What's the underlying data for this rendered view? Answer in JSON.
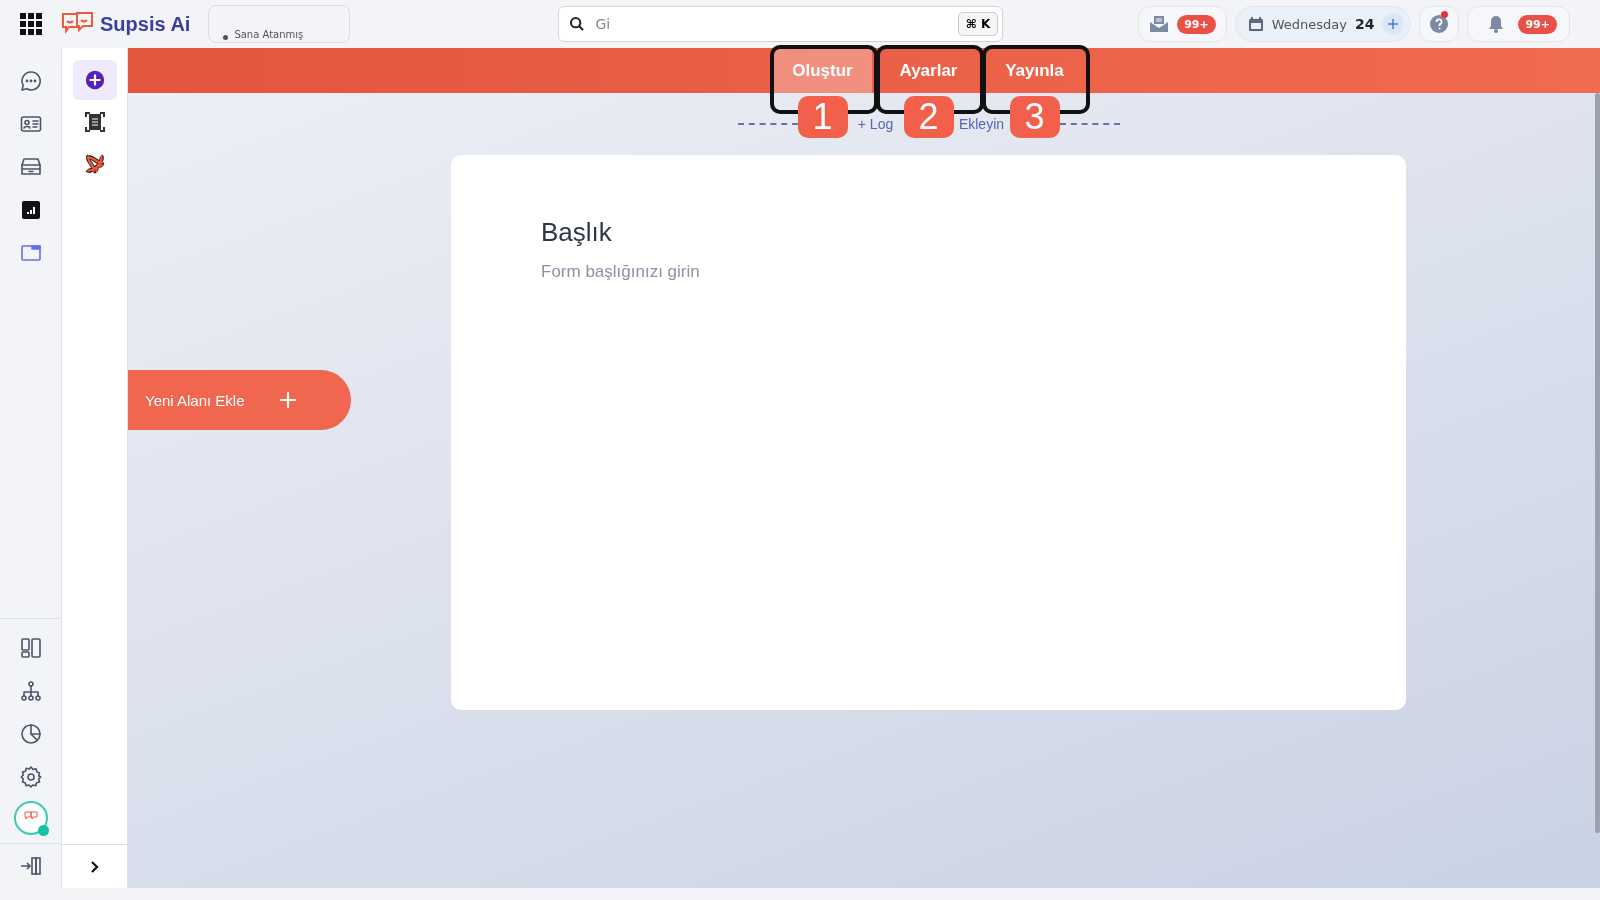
{
  "topbar": {
    "brand": "Supsis Ai",
    "assigned_filter": "Sana Atanmış",
    "search": {
      "placeholder": "Gi",
      "shortcut": "⌘ K"
    },
    "mail_badge": "99+",
    "date": {
      "day": "Wednesday",
      "date": "24"
    },
    "help_alert": true,
    "notifications_badge": "99+"
  },
  "rail": [
    {
      "kind": "chat",
      "selected": false
    },
    {
      "kind": "contact",
      "selected": false
    },
    {
      "kind": "inbox",
      "selected": false
    },
    {
      "kind": "report",
      "selected": false
    },
    {
      "kind": "window",
      "selected": true
    }
  ],
  "rail_bottom": [
    {
      "kind": "layout"
    },
    {
      "kind": "hierarchy"
    },
    {
      "kind": "pie"
    },
    {
      "kind": "settings"
    }
  ],
  "avatar": {
    "online": true
  },
  "tools": [
    {
      "kind": "add",
      "selected": true
    },
    {
      "kind": "scan",
      "selected": false
    },
    {
      "kind": "brand",
      "selected": false
    }
  ],
  "tabs": [
    {
      "label": "Oluştur",
      "selected": true,
      "callout": "1"
    },
    {
      "label": "Ayarlar",
      "selected": false,
      "callout": "2"
    },
    {
      "label": "Yayınla",
      "selected": false,
      "callout": "3"
    }
  ],
  "logo_link": [
    "+ Log",
    "Ekleyin"
  ],
  "form": {
    "title": "Başlık",
    "subtitle": "Form başlığınızı girin"
  },
  "add_field_button": "Yeni Alanı Ekle"
}
